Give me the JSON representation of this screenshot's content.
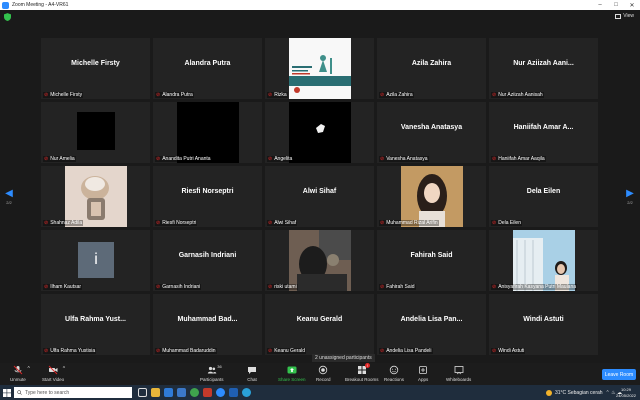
{
  "window": {
    "title": "Zoom Meeting - A4-VR61"
  },
  "meeting": {
    "view_label": "View",
    "page_left": "2/2",
    "page_right": "2/2",
    "unassigned": "2 unassigned participants"
  },
  "tiles": [
    {
      "big": "Michelle Firsty",
      "small": "Michelle Firsty",
      "type": "name"
    },
    {
      "big": "Alandra Putra",
      "small": "Alandra Putra",
      "type": "name"
    },
    {
      "big": "",
      "small": "Rizka",
      "type": "poster"
    },
    {
      "big": "Azila Zahira",
      "small": "Azila Zahira",
      "type": "name"
    },
    {
      "big": "Nur Aziizah Aani...",
      "small": "Nur Aziizah Aanisah",
      "type": "name"
    },
    {
      "big": "",
      "small": "Nur Amelia",
      "type": "black"
    },
    {
      "big": "",
      "small": "Anandita Putri Ananta",
      "type": "black"
    },
    {
      "big": "",
      "small": "Angelita",
      "type": "hand"
    },
    {
      "big": "Vanesha Anatasya",
      "small": "Vanesha Anatasya",
      "type": "name"
    },
    {
      "big": "Haniifah Amar A...",
      "small": "Haniifah Amar Aaqila",
      "type": "name"
    },
    {
      "big": "",
      "small": "Shahnaz Adila",
      "type": "photo1"
    },
    {
      "big": "Riesfi Norseptri",
      "small": "Riesfi Norseptri",
      "type": "name"
    },
    {
      "big": "Alwi Sihaf",
      "small": "Alwi Sihaf",
      "type": "name"
    },
    {
      "big": "",
      "small": "Muhammad Rizal Arifin",
      "type": "photo2"
    },
    {
      "big": "Dela Eilen",
      "small": "Dela Eilen",
      "type": "name"
    },
    {
      "big": "i",
      "small": "Ilham Kautsar",
      "type": "initial"
    },
    {
      "big": "Garnasih Indriani",
      "small": "Garnasih Indriani",
      "type": "name"
    },
    {
      "big": "",
      "small": "riski utami",
      "type": "photo3"
    },
    {
      "big": "Fahirah Said",
      "small": "Fahirah Said",
      "type": "name"
    },
    {
      "big": "",
      "small": "Anisyafirah Kasyana Putri Maulana",
      "type": "photo4"
    },
    {
      "big": "Ulfa Rahma Yust...",
      "small": "Ulfa Rahma Yustisia",
      "type": "name"
    },
    {
      "big": "Muhammad Bad...",
      "small": "Muhammad Badaruddin",
      "type": "name"
    },
    {
      "big": "Keanu Gerald",
      "small": "Keanu Gerald",
      "type": "name"
    },
    {
      "big": "Andelia Lisa Pan...",
      "small": "Andelia Lisa Pandeli",
      "type": "name"
    },
    {
      "big": "Windi Astuti",
      "small": "Windi Astuti",
      "type": "name"
    }
  ],
  "toolbar": {
    "unmute": "Unmute",
    "start_video": "Start Video",
    "participants": "Participants",
    "participants_count": "36",
    "chat": "Chat",
    "share_screen": "Share Screen",
    "record": "Record",
    "breakout": "Breakout Rooms",
    "reactions": "Reactions",
    "apps": "Apps",
    "whiteboards": "Whiteboards",
    "leave": "Leave Room"
  },
  "taskbar": {
    "search_placeholder": "Type here to search",
    "weather": "31°C  Sebagian cerah",
    "time": "10:29",
    "date": "24/05/2022"
  },
  "colors": {
    "accent": "#2d8cff",
    "share_green": "#33c24d",
    "mute_red": "#e02828"
  }
}
